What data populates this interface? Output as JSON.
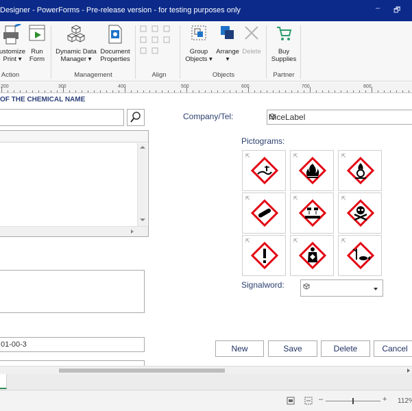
{
  "window": {
    "title": "Designer - PowerForms - Pre-release version - for testing purposes only",
    "minimize": "–",
    "restore": "🗗"
  },
  "ribbon": {
    "action": {
      "customize_print": [
        "ustomize",
        "Print ▾"
      ],
      "run_form": [
        "Run",
        "Form"
      ],
      "group_label": "Action"
    },
    "management": {
      "dynamic_data_manager": [
        "Dynamic Data",
        "Manager ▾"
      ],
      "document_properties": [
        "Document",
        "Properties"
      ],
      "group_label": "Management"
    },
    "align": {
      "group_label": "Align"
    },
    "objects": {
      "group_objects": [
        "Group",
        "Objects ▾"
      ],
      "arrange": [
        "Arrange",
        "▾"
      ],
      "delete": "Delete",
      "group_label": "Objects"
    },
    "partner": {
      "buy_supplies": [
        "Buy",
        "Supplies"
      ],
      "group_label": "Partner"
    }
  },
  "ruler": {
    "labels": [
      "200",
      "300",
      "400",
      "500",
      "600",
      "700",
      "800"
    ]
  },
  "form": {
    "header": "OF THE CHEMICAL NAME",
    "company_label": "Company/Tel:",
    "company_value": "NiceLabel",
    "pictograms_label": "Pictograms:",
    "signalword_label": "Signalword:",
    "cas_value": "01-00-3",
    "buttons": {
      "new": "New",
      "save": "Save",
      "delete": "Delete",
      "cancel": "Cancel"
    }
  },
  "status": {
    "zoom": "112%"
  }
}
